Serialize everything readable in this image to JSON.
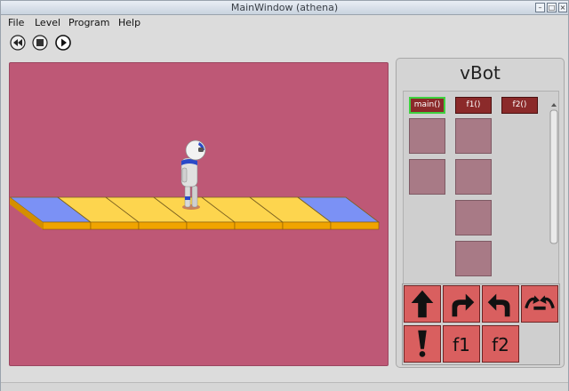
{
  "window": {
    "title": "MainWindow (athena)"
  },
  "menu": {
    "items": [
      "File",
      "Level",
      "Program",
      "Help"
    ]
  },
  "toolbar": {
    "buttons": [
      {
        "name": "rewind",
        "icon": "rewind-icon"
      },
      {
        "name": "stop",
        "icon": "stop-icon"
      },
      {
        "name": "play",
        "icon": "play-icon"
      }
    ]
  },
  "scene": {
    "background": "#be5876",
    "tiles": [
      "blue",
      "yellow",
      "yellow",
      "yellow",
      "yellow",
      "yellow",
      "blue"
    ],
    "colors": {
      "yellow": "#fdd54e",
      "blue": "#7b91f5",
      "edge": "#f0a400"
    }
  },
  "side": {
    "title": "vBot",
    "functions": [
      {
        "label": "main()",
        "selected": true,
        "slots": 2
      },
      {
        "label": "f1()",
        "selected": false,
        "slots": 4
      },
      {
        "label": "f2()",
        "selected": false,
        "slots": 0
      }
    ],
    "commands": [
      {
        "name": "forward",
        "icon": "up-arrow-icon",
        "label": ""
      },
      {
        "name": "turn-right",
        "icon": "turn-right-icon",
        "label": ""
      },
      {
        "name": "turn-left",
        "icon": "turn-left-icon",
        "label": ""
      },
      {
        "name": "jump",
        "icon": "jump-icon",
        "label": ""
      },
      {
        "name": "light",
        "icon": "exclamation-icon",
        "label": ""
      },
      {
        "name": "call-f1",
        "icon": "",
        "label": "f1"
      },
      {
        "name": "call-f2",
        "icon": "",
        "label": "f2"
      }
    ]
  }
}
